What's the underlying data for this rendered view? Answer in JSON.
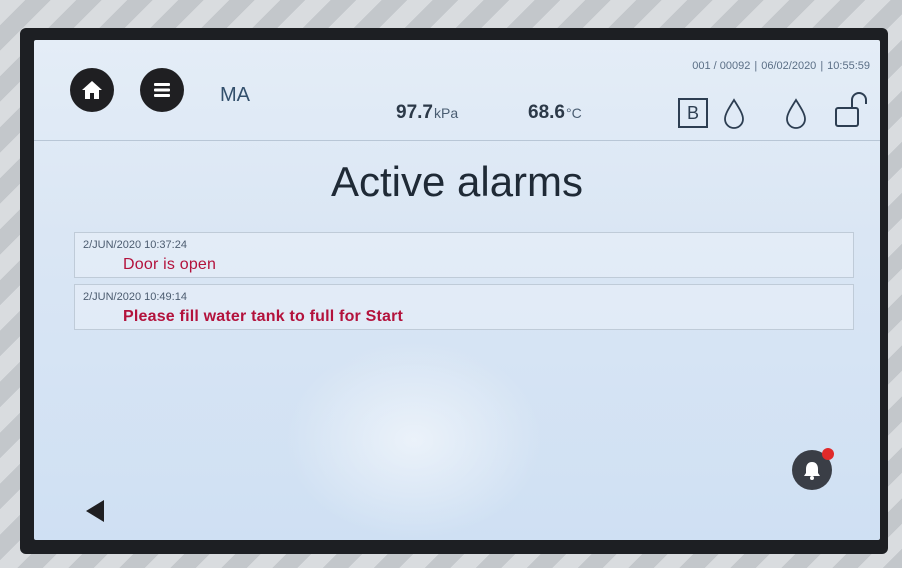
{
  "header": {
    "user": "MA",
    "counter": "001 / 00092",
    "date": "06/02/2020",
    "time": "10:55:59",
    "pressure_value": "97.7",
    "pressure_unit": "kPa",
    "temperature_value": "68.6",
    "temperature_unit": "°C",
    "mode": "B"
  },
  "page": {
    "title": "Active alarms"
  },
  "alarms": [
    {
      "timestamp": "2/JUN/2020 10:37:24",
      "message": "Door is open"
    },
    {
      "timestamp": "2/JUN/2020 10:49:14",
      "message": "Please fill water tank to full for Start"
    }
  ],
  "icons": {
    "home": "home-icon",
    "menu": "menu-icon",
    "drop": "water-drop-icon",
    "lock": "unlocked-icon",
    "back": "back-arrow-icon",
    "bell": "alarm-bell-icon"
  },
  "colors": {
    "alarm_text": "#b3123c",
    "alarm_badge": "#e02a2a"
  }
}
